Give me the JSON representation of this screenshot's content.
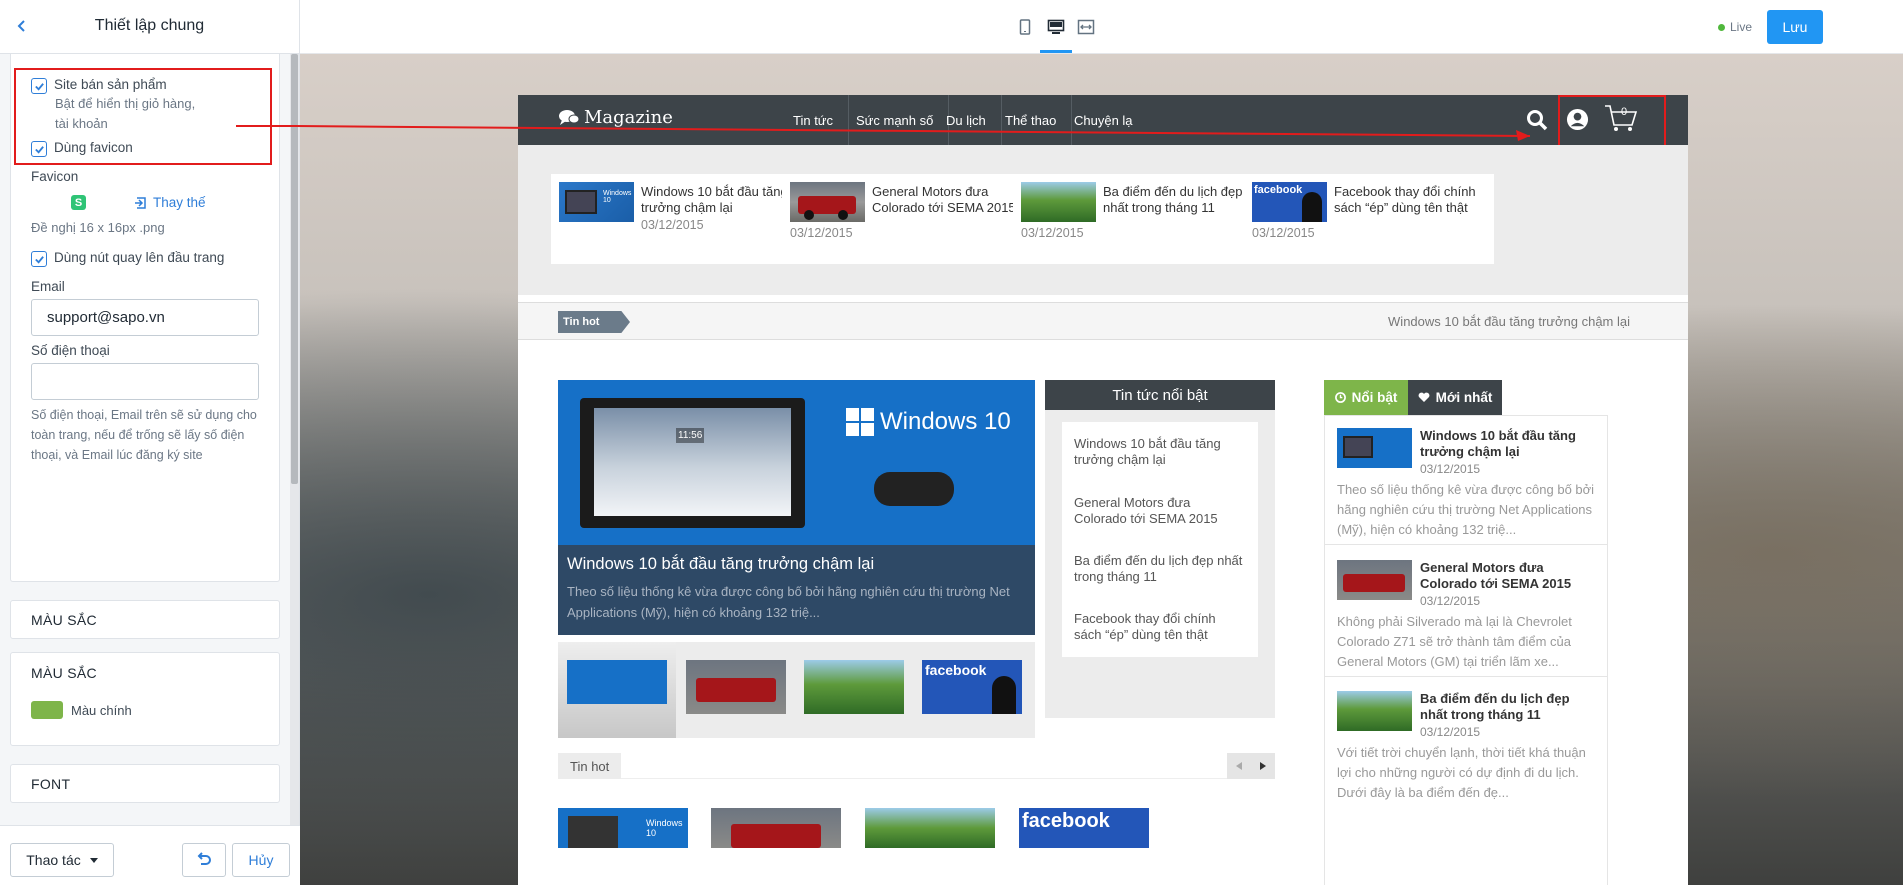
{
  "sidebar": {
    "title": "Thiết lập chung",
    "sell_products_label": "Site bán sản phẩm",
    "sell_products_help": "Bật để hiển thị giỏ hàng, tài khoản",
    "use_favicon_label": "Dùng favicon",
    "favicon_label": "Favicon",
    "favicon_replace": "Thay thế",
    "favicon_hint": "Đề nghị 16 x 16px .png",
    "back_to_top_label": "Dùng nút quay lên đầu trang",
    "email_label": "Email",
    "email_value": "support@sapo.vn",
    "phone_label": "Số điện thoại",
    "phone_value": "",
    "contact_help": "Số điện thoại, Email trên sẽ sử dụng cho toàn trang, nếu để trống sẽ lấy số điện thoại, và Email lúc đăng ký site",
    "section_colors_1": "MÀU SẮC",
    "section_colors_2": "MÀU SẮC",
    "main_color_label": "Màu chính",
    "main_color": "#7eb54a",
    "section_font": "FONT",
    "actions_button": "Thao tác",
    "cancel_button": "Hủy"
  },
  "topbar": {
    "live_label": "Live",
    "save_label": "Lưu"
  },
  "site": {
    "logo_text": "Magazine",
    "nav": [
      "Tin tức",
      "Sức mạnh số",
      "Du lịch",
      "Thể thao",
      "Chuyện lạ"
    ],
    "cart_count": "0",
    "strip": [
      {
        "title": "Windows 10 bắt đầu tăng trưởng chậm lại",
        "date": "03/12/2015"
      },
      {
        "title": "General Motors đưa Colorado tới SEMA 2015",
        "date": "03/12/2015"
      },
      {
        "title": "Ba điểm đến du lịch đẹp nhất trong tháng 11",
        "date": "03/12/2015"
      },
      {
        "title": "Facebook thay đổi chính sách “ép” dùng tên thật",
        "date": "03/12/2015"
      }
    ],
    "hot_tag": "Tin hot",
    "hot_headline": "Windows 10 bắt đầu tăng trưởng chậm lại",
    "feature": {
      "title": "Windows 10 bắt đầu tăng trưởng chậm lại",
      "summary": "Theo số liệu thống kê vừa được công bố bởi hãng nghiên cứu thị trường Net Applications (Mỹ), hiện có khoảng 132 triệ...",
      "image_text": "Windows 10",
      "clock": "11:56"
    },
    "featured_box": {
      "title": "Tin tức nổi bật",
      "items": [
        "Windows 10 bắt đầu tăng trưởng chậm lại",
        "General Motors đưa Colorado tới SEMA 2015",
        "Ba điểm đến du lịch đẹp nhất trong tháng 11",
        "Facebook thay đổi chính sách “ép” dùng tên thật"
      ]
    },
    "tin_hot_section": "Tin hot",
    "tabs": {
      "featured": "Nổi bật",
      "latest": "Mới nhất"
    },
    "tab_items": [
      {
        "title": "Windows 10 bắt đầu tăng trưởng chậm lại",
        "date": "03/12/2015",
        "desc": "Theo số liệu thống kê vừa được công bố bởi hãng nghiên cứu thị trường Net Applications (Mỹ), hiện có khoảng 132 triệ..."
      },
      {
        "title": "General Motors đưa Colorado tới SEMA 2015",
        "date": "03/12/2015",
        "desc": "Không phải Silverado mà lại là Chevrolet Colorado Z71 sẽ trở thành tâm điểm của General Motors (GM) tại triển lãm xe..."
      },
      {
        "title": "Ba điểm đến du lịch đẹp nhất trong tháng 11",
        "date": "03/12/2015",
        "desc": "Với tiết trời chuyển lạnh, thời tiết khá thuận lợi cho những người có dự định đi du lịch. Dưới đây là ba điểm đến đẹ..."
      }
    ],
    "facebook_label": "facebook",
    "windows_label": "Windows 10"
  },
  "icons": {
    "back": "chevron-left-icon",
    "checkbox": "checkmark-icon",
    "favicon": "sapo-favicon-icon",
    "replace": "replace-icon",
    "undo": "undo-icon",
    "device_mobile": "mobile-icon",
    "device_desktop": "desktop-icon",
    "device_fullwidth": "fullwidth-icon",
    "search": "search-icon",
    "account": "account-icon",
    "cart": "cart-icon"
  },
  "colors": {
    "accent": "#2196f3",
    "annotation": "#e21c1c",
    "live": "#50b83c"
  }
}
